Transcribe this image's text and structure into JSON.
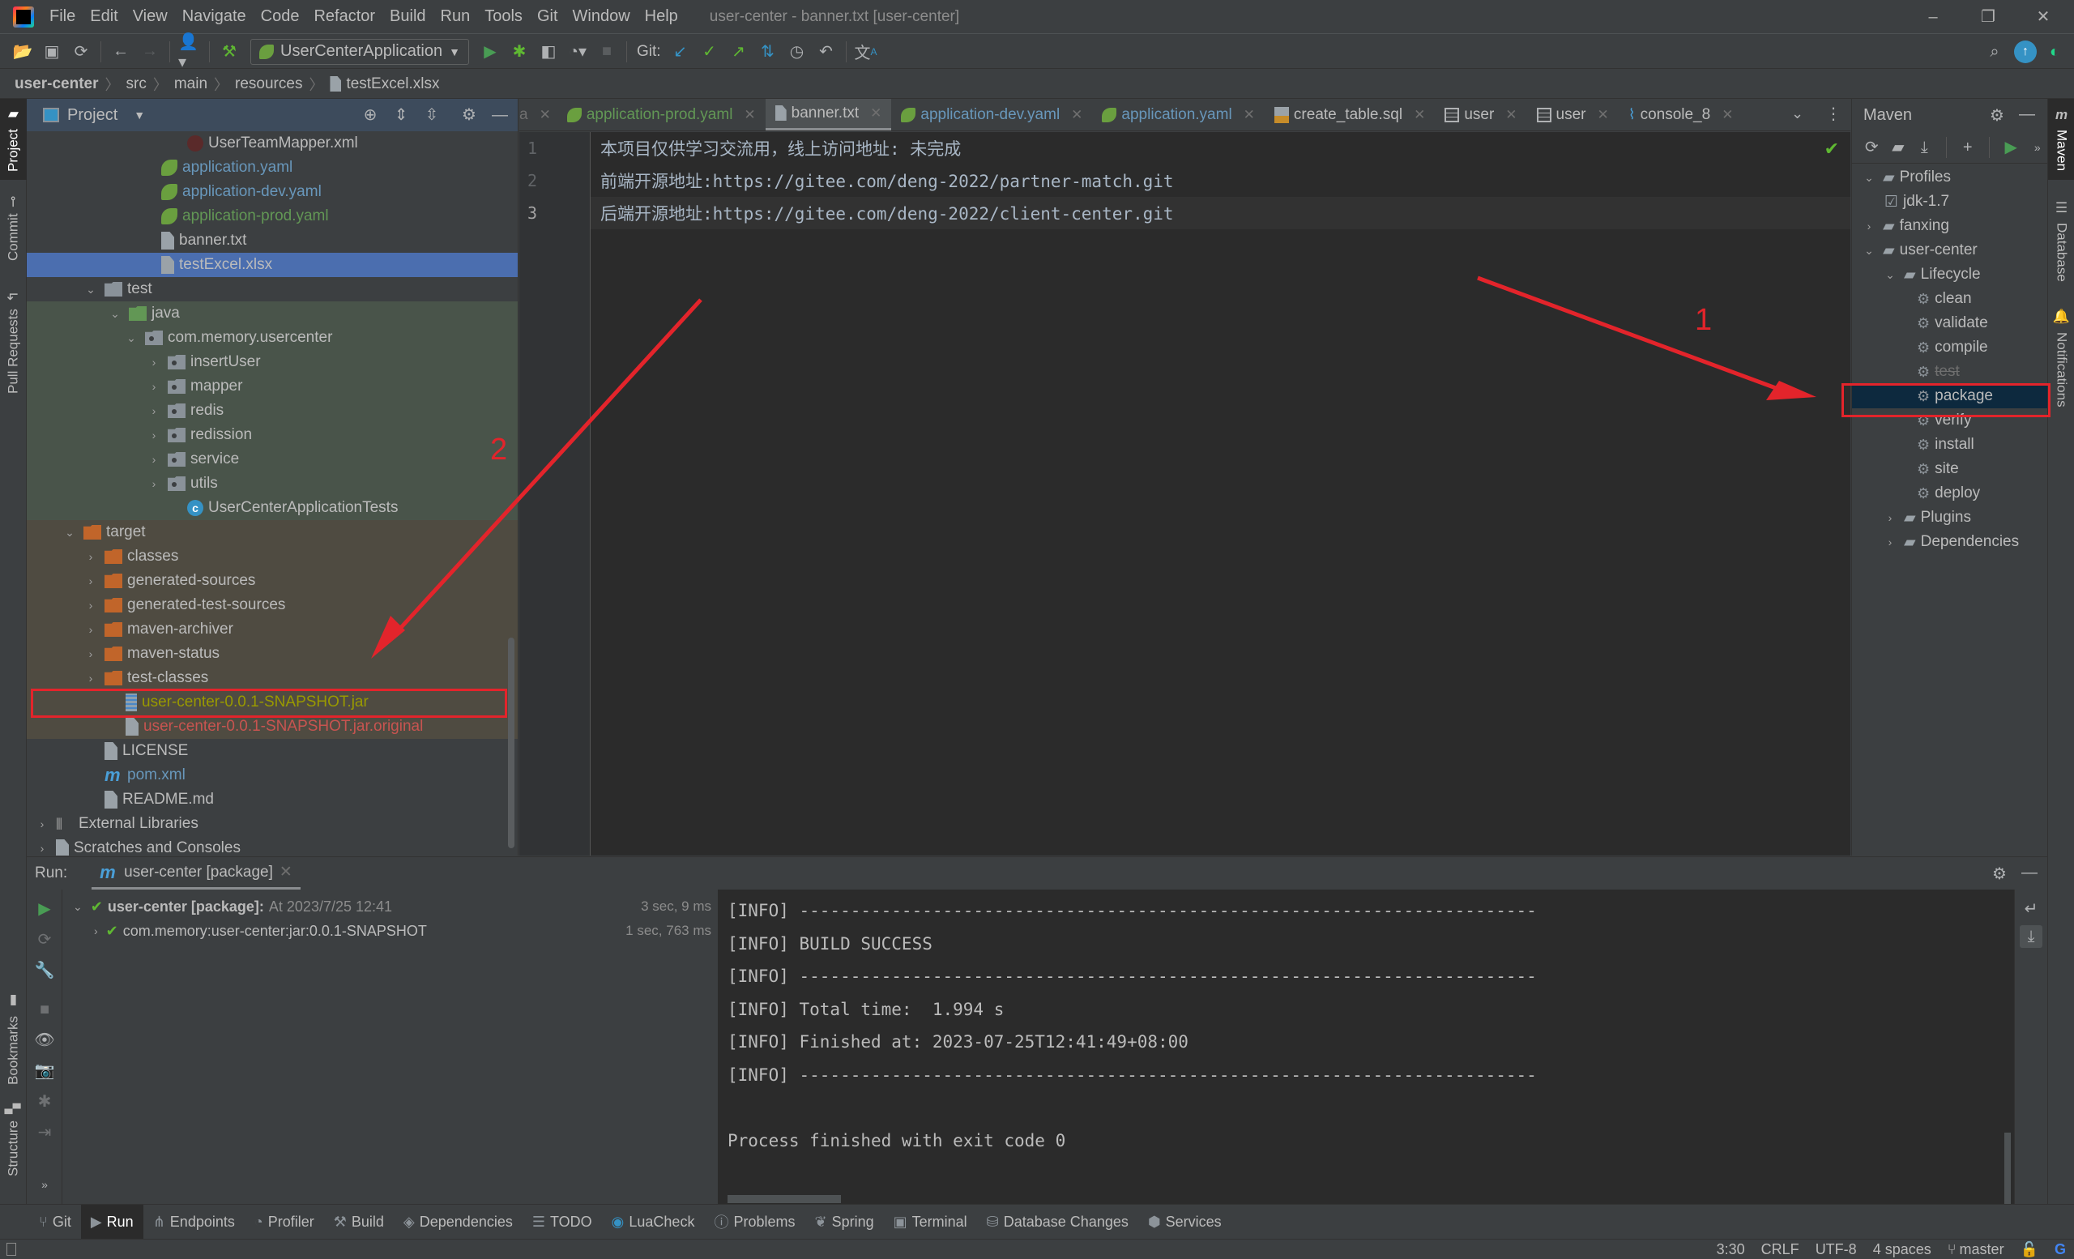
{
  "window": {
    "title": "user-center - banner.txt [user-center]",
    "menu": [
      "File",
      "Edit",
      "View",
      "Navigate",
      "Code",
      "Refactor",
      "Build",
      "Run",
      "Tools",
      "Git",
      "Window",
      "Help"
    ],
    "controls": {
      "minimize": "–",
      "restore": "❐",
      "close": "✕"
    }
  },
  "toolbar": {
    "run_config": "UserCenterApplication",
    "git_label": "Git:"
  },
  "breadcrumb": [
    "user-center",
    "src",
    "main",
    "resources",
    "testExcel.xlsx"
  ],
  "left_stripe": {
    "project": "Project",
    "commit": "Commit",
    "pull_requests": "Pull Requests",
    "bookmarks": "Bookmarks",
    "structure": "Structure"
  },
  "right_stripe": {
    "maven": "Maven",
    "database": "Database",
    "notifications": "Notifications"
  },
  "project_panel": {
    "title": "Project",
    "tree": [
      {
        "label": "UserTeamMapper.xml",
        "icon": "mybatis-xml-icon",
        "color": "default",
        "bg": "none"
      },
      {
        "label": "application.yaml",
        "icon": "spring-config-icon",
        "color": "blue",
        "bg": "none"
      },
      {
        "label": "application-dev.yaml",
        "icon": "spring-config-icon",
        "color": "blue",
        "bg": "none"
      },
      {
        "label": "application-prod.yaml",
        "icon": "spring-config-icon",
        "color": "green",
        "bg": "none"
      },
      {
        "label": "banner.txt",
        "icon": "text-file-icon",
        "color": "default",
        "bg": "none"
      },
      {
        "label": "testExcel.xlsx",
        "icon": "unknown-file-icon",
        "color": "default",
        "bg": "selected"
      },
      {
        "label": "test",
        "icon": "folder-icon",
        "color": "default",
        "bg": "none",
        "expanded": true
      },
      {
        "label": "java",
        "icon": "test-source-folder-icon",
        "color": "default",
        "bg": "test",
        "expanded": true
      },
      {
        "label": "com.memory.usercenter",
        "icon": "package-icon",
        "color": "default",
        "bg": "test",
        "expanded": true
      },
      {
        "label": "insertUser",
        "icon": "package-icon",
        "color": "default",
        "bg": "test",
        "expanded": false
      },
      {
        "label": "mapper",
        "icon": "package-icon",
        "color": "default",
        "bg": "test",
        "expanded": false
      },
      {
        "label": "redis",
        "icon": "package-icon",
        "color": "default",
        "bg": "test",
        "expanded": false
      },
      {
        "label": "redission",
        "icon": "package-icon",
        "color": "default",
        "bg": "test",
        "expanded": false
      },
      {
        "label": "service",
        "icon": "package-icon",
        "color": "default",
        "bg": "test",
        "expanded": false
      },
      {
        "label": "utils",
        "icon": "package-icon",
        "color": "default",
        "bg": "test",
        "expanded": false
      },
      {
        "label": "UserCenterApplicationTests",
        "icon": "test-class-icon",
        "color": "default",
        "bg": "test"
      },
      {
        "label": "target",
        "icon": "excluded-folder-icon",
        "color": "default",
        "bg": "excluded",
        "expanded": true
      },
      {
        "label": "classes",
        "icon": "excluded-folder-icon",
        "color": "default",
        "bg": "excluded",
        "expanded": false
      },
      {
        "label": "generated-sources",
        "icon": "excluded-folder-icon",
        "color": "default",
        "bg": "excluded",
        "expanded": false
      },
      {
        "label": "generated-test-sources",
        "icon": "excluded-folder-icon",
        "color": "default",
        "bg": "excluded",
        "expanded": false
      },
      {
        "label": "maven-archiver",
        "icon": "excluded-folder-icon",
        "color": "default",
        "bg": "excluded",
        "expanded": false
      },
      {
        "label": "maven-status",
        "icon": "excluded-folder-icon",
        "color": "default",
        "bg": "excluded",
        "expanded": false
      },
      {
        "label": "test-classes",
        "icon": "excluded-folder-icon",
        "color": "default",
        "bg": "excluded",
        "expanded": false
      },
      {
        "label": "user-center-0.0.1-SNAPSHOT.jar",
        "icon": "jar-icon",
        "color": "olive",
        "bg": "excluded"
      },
      {
        "label": "user-center-0.0.1-SNAPSHOT.jar.original",
        "icon": "unknown-file-icon",
        "color": "red",
        "bg": "excluded"
      },
      {
        "label": "LICENSE",
        "icon": "text-file-icon",
        "color": "default",
        "bg": "none"
      },
      {
        "label": "pom.xml",
        "icon": "maven-icon",
        "color": "blue",
        "bg": "none"
      },
      {
        "label": "README.md",
        "icon": "markdown-icon",
        "color": "default",
        "bg": "none"
      },
      {
        "label": "External Libraries",
        "icon": "libraries-icon",
        "color": "default",
        "bg": "none",
        "expanded": false
      },
      {
        "label": "Scratches and Consoles",
        "icon": "scratches-icon",
        "color": "default",
        "bg": "none",
        "expanded": false
      }
    ]
  },
  "editor": {
    "tabs": [
      {
        "label": "a",
        "icon": "none",
        "color": "default",
        "active": false
      },
      {
        "label": "application-prod.yaml",
        "icon": "spring",
        "color": "green",
        "active": false
      },
      {
        "label": "banner.txt",
        "icon": "file",
        "color": "default",
        "active": true
      },
      {
        "label": "application-dev.yaml",
        "icon": "spring",
        "color": "blue",
        "active": false
      },
      {
        "label": "application.yaml",
        "icon": "spring",
        "color": "blue",
        "active": false
      },
      {
        "label": "create_table.sql",
        "icon": "sql",
        "color": "default",
        "active": false
      },
      {
        "label": "user",
        "icon": "table",
        "color": "default",
        "active": false
      },
      {
        "label": "user",
        "icon": "table",
        "color": "default",
        "active": false
      },
      {
        "label": "console_8",
        "icon": "console",
        "color": "default",
        "active": false
      }
    ],
    "lines": [
      {
        "num": "1",
        "text": "本项目仅供学习交流用，线上访问地址: 未完成"
      },
      {
        "num": "2",
        "text": "前端开源地址:https://gitee.com/deng-2022/partner-match.git"
      },
      {
        "num": "3",
        "text": "后端开源地址:https://gitee.com/deng-2022/client-center.git"
      }
    ],
    "current_line": 3
  },
  "maven_panel": {
    "title": "Maven",
    "tree": [
      {
        "label": "Profiles",
        "icon": "profiles-icon",
        "level": 0,
        "chev": "down"
      },
      {
        "label": "jdk-1.7",
        "icon": "checkbox-checked",
        "level": 1,
        "chev": "none"
      },
      {
        "label": "fanxing",
        "icon": "maven-project-icon",
        "level": 0,
        "chev": "right"
      },
      {
        "label": "user-center",
        "icon": "maven-project-icon",
        "level": 0,
        "chev": "down"
      },
      {
        "label": "Lifecycle",
        "icon": "lifecycle-folder-icon",
        "level": 1,
        "chev": "down"
      },
      {
        "label": "clean",
        "icon": "gear-icon",
        "level": 2,
        "chev": "none"
      },
      {
        "label": "validate",
        "icon": "gear-icon",
        "level": 2,
        "chev": "none"
      },
      {
        "label": "compile",
        "icon": "gear-icon",
        "level": 2,
        "chev": "none"
      },
      {
        "label": "test",
        "icon": "gear-icon",
        "level": 2,
        "chev": "none",
        "skipped": true
      },
      {
        "label": "package",
        "icon": "gear-icon",
        "level": 2,
        "chev": "none",
        "selected": true
      },
      {
        "label": "verify",
        "icon": "gear-icon",
        "level": 2,
        "chev": "none"
      },
      {
        "label": "install",
        "icon": "gear-icon",
        "level": 2,
        "chev": "none"
      },
      {
        "label": "site",
        "icon": "gear-icon",
        "level": 2,
        "chev": "none"
      },
      {
        "label": "deploy",
        "icon": "gear-icon",
        "level": 2,
        "chev": "none"
      },
      {
        "label": "Plugins",
        "icon": "plugins-folder-icon",
        "level": 1,
        "chev": "right"
      },
      {
        "label": "Dependencies",
        "icon": "dependencies-icon",
        "level": 1,
        "chev": "right"
      }
    ]
  },
  "run_panel": {
    "label": "Run:",
    "tab": "user-center [package]",
    "tree": [
      {
        "title": "user-center [package]:",
        "detail": "At 2023/7/25 12:41",
        "time": "3 sec, 9 ms"
      },
      {
        "title": "com.memory:user-center:jar:0.0.1-SNAPSHOT",
        "detail": "",
        "time": "1 sec, 763 ms"
      }
    ],
    "console": [
      "[INFO] ------------------------------------------------------------------------",
      "[INFO] BUILD SUCCESS",
      "[INFO] ------------------------------------------------------------------------",
      "[INFO] Total time:  1.994 s",
      "[INFO] Finished at: 2023-07-25T12:41:49+08:00",
      "[INFO] ------------------------------------------------------------------------",
      "",
      "Process finished with exit code 0"
    ]
  },
  "bottom_bar": [
    {
      "label": "Git",
      "icon": "git-branch-icon",
      "active": false
    },
    {
      "label": "Run",
      "icon": "run-icon",
      "active": true
    },
    {
      "label": "Endpoints",
      "icon": "endpoints-icon",
      "active": false
    },
    {
      "label": "Profiler",
      "icon": "profiler-icon",
      "active": false
    },
    {
      "label": "Build",
      "icon": "hammer-icon",
      "active": false
    },
    {
      "label": "Dependencies",
      "icon": "dependencies-icon",
      "active": false
    },
    {
      "label": "TODO",
      "icon": "todo-icon",
      "active": false
    },
    {
      "label": "LuaCheck",
      "icon": "luacheck-icon",
      "active": false
    },
    {
      "label": "Problems",
      "icon": "problems-icon",
      "active": false
    },
    {
      "label": "Spring",
      "icon": "spring-icon",
      "active": false
    },
    {
      "label": "Terminal",
      "icon": "terminal-icon",
      "active": false
    },
    {
      "label": "Database Changes",
      "icon": "database-changes-icon",
      "active": false
    },
    {
      "label": "Services",
      "icon": "services-icon",
      "active": false
    }
  ],
  "status_bar": {
    "position": "3:30",
    "line_separator": "CRLF",
    "encoding": "UTF-8",
    "indent": "4 spaces",
    "branch": "master"
  },
  "annotations": {
    "label_1": "1",
    "label_2": "2",
    "color": "#e3242b"
  }
}
